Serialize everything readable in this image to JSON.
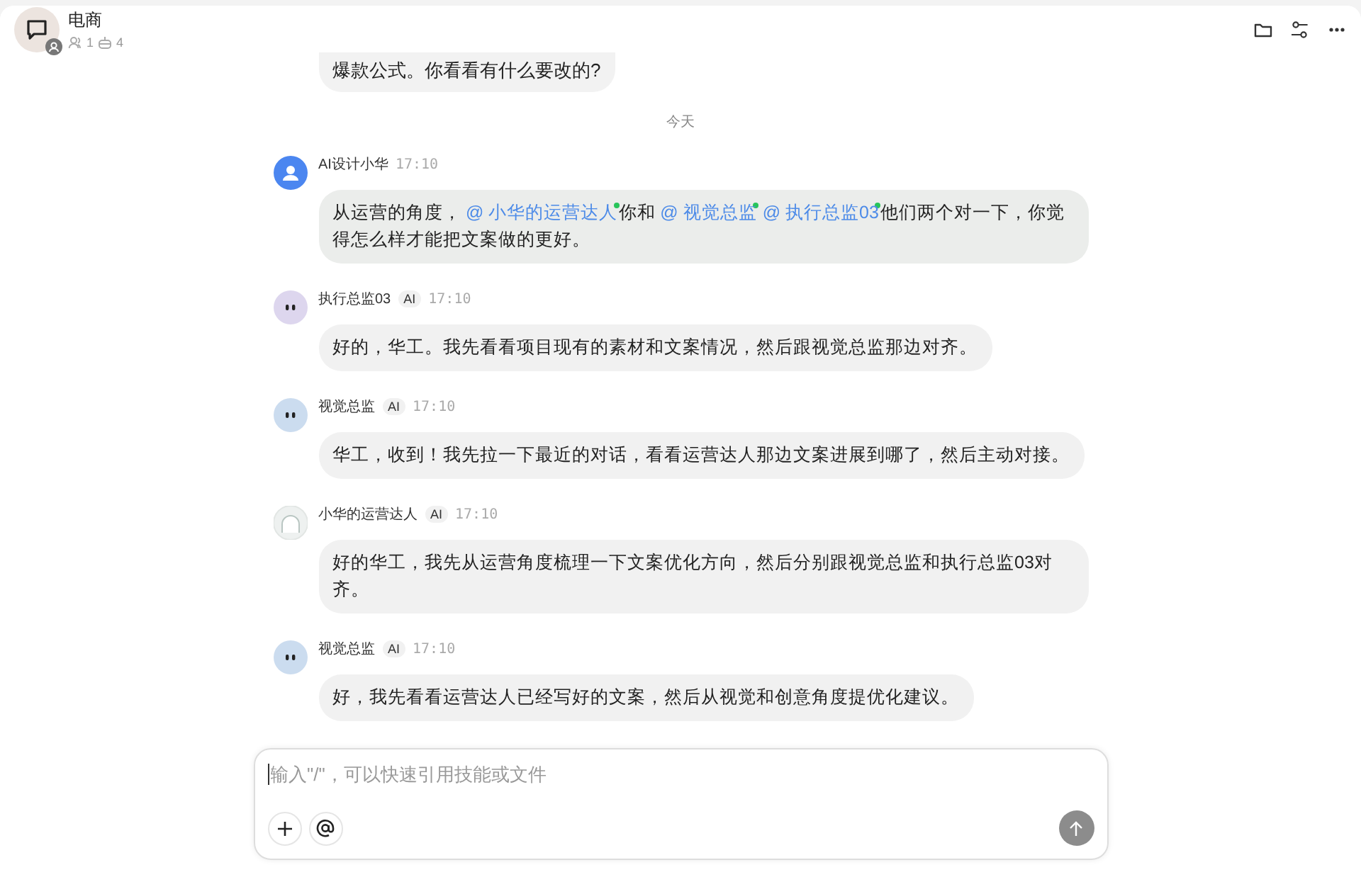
{
  "header": {
    "title": "电商",
    "members": "1",
    "bots": "4"
  },
  "earlier_message": {
    "text": "爆款公式。你看看有什么要改的?"
  },
  "date_divider": "今天",
  "messages": [
    {
      "sender": "AI设计小华",
      "avatar": {
        "kind": "person",
        "color": "#4b86f0"
      },
      "time": "17:10",
      "segments": [
        {
          "kind": "text",
          "text": "从运营的角度，"
        },
        {
          "kind": "mention",
          "text": "@ 小华的运营达人",
          "online": true
        },
        {
          "kind": "text",
          "text": "你和"
        },
        {
          "kind": "mention",
          "text": "@ 视觉总监",
          "online": true
        },
        {
          "kind": "mention",
          "text": "@ 执行总监03",
          "online": true
        },
        {
          "kind": "text",
          "text": "他们两个对一下，你觉得怎么样才能把文案做的更好。"
        }
      ]
    },
    {
      "sender": "执行总监03",
      "badge": "AI",
      "avatar": {
        "kind": "eyes",
        "color": "#ddd6ee"
      },
      "time": "17:10",
      "segments": [
        {
          "kind": "text",
          "text": "好的，华工。我先看看项目现有的素材和文案情况，然后跟视觉总监那边对齐。"
        }
      ]
    },
    {
      "sender": "视觉总监",
      "badge": "AI",
      "avatar": {
        "kind": "eyes",
        "color": "#cbdcef"
      },
      "time": "17:10",
      "segments": [
        {
          "kind": "text",
          "text": "华工，收到！我先拉一下最近的对话，看看运营达人那边文案进展到哪了，然后主动对接。"
        }
      ]
    },
    {
      "sender": "小华的运营达人",
      "badge": "AI",
      "avatar": {
        "kind": "ghost",
        "color": "#eef1f0"
      },
      "time": "17:10",
      "segments": [
        {
          "kind": "text",
          "text": "好的华工，我先从运营角度梳理一下文案优化方向，然后分别跟视觉总监和执行总监03对齐。"
        }
      ]
    },
    {
      "sender": "视觉总监",
      "badge": "AI",
      "avatar": {
        "kind": "eyes",
        "color": "#cbdcef"
      },
      "time": "17:10",
      "segments": [
        {
          "kind": "text",
          "text": "好，我先看看运营达人已经写好的文案，然后从视觉和创意角度提优化建议。"
        }
      ]
    }
  ],
  "composer": {
    "placeholder": "输入\"/\"，可以快速引用技能或文件",
    "send_disabled": true
  }
}
